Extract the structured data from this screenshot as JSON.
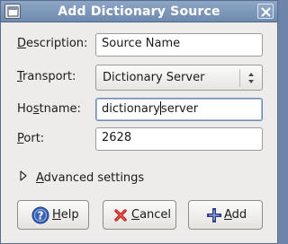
{
  "window": {
    "title": "Add Dictionary Source"
  },
  "form": {
    "description": {
      "label_first": "D",
      "label_rest": "escription:",
      "value": "Source Name"
    },
    "transport": {
      "label_first": "T",
      "label_rest": "ransport:",
      "value": "Dictionary Server"
    },
    "hostname": {
      "label_first": "Ho",
      "label_u": "s",
      "label_rest": "tname:",
      "value_before": "dictionary",
      "value_after": "server"
    },
    "port": {
      "label_first": "P",
      "label_rest": "ort:",
      "value": "2628"
    }
  },
  "advanced": {
    "label_first": "A",
    "label_rest": "dvanced settings",
    "expanded": false
  },
  "buttons": {
    "help": {
      "label_first": "H",
      "label_rest": "elp"
    },
    "cancel": {
      "label_first": "C",
      "label_rest": "ancel"
    },
    "add": {
      "label_first": "A",
      "label_rest": "dd"
    }
  },
  "colors": {
    "titlebar": "#7b93b8",
    "help_icon": "#3a62b6",
    "cancel_icon": "#c0201b",
    "add_icon": "#3f4fa0"
  }
}
